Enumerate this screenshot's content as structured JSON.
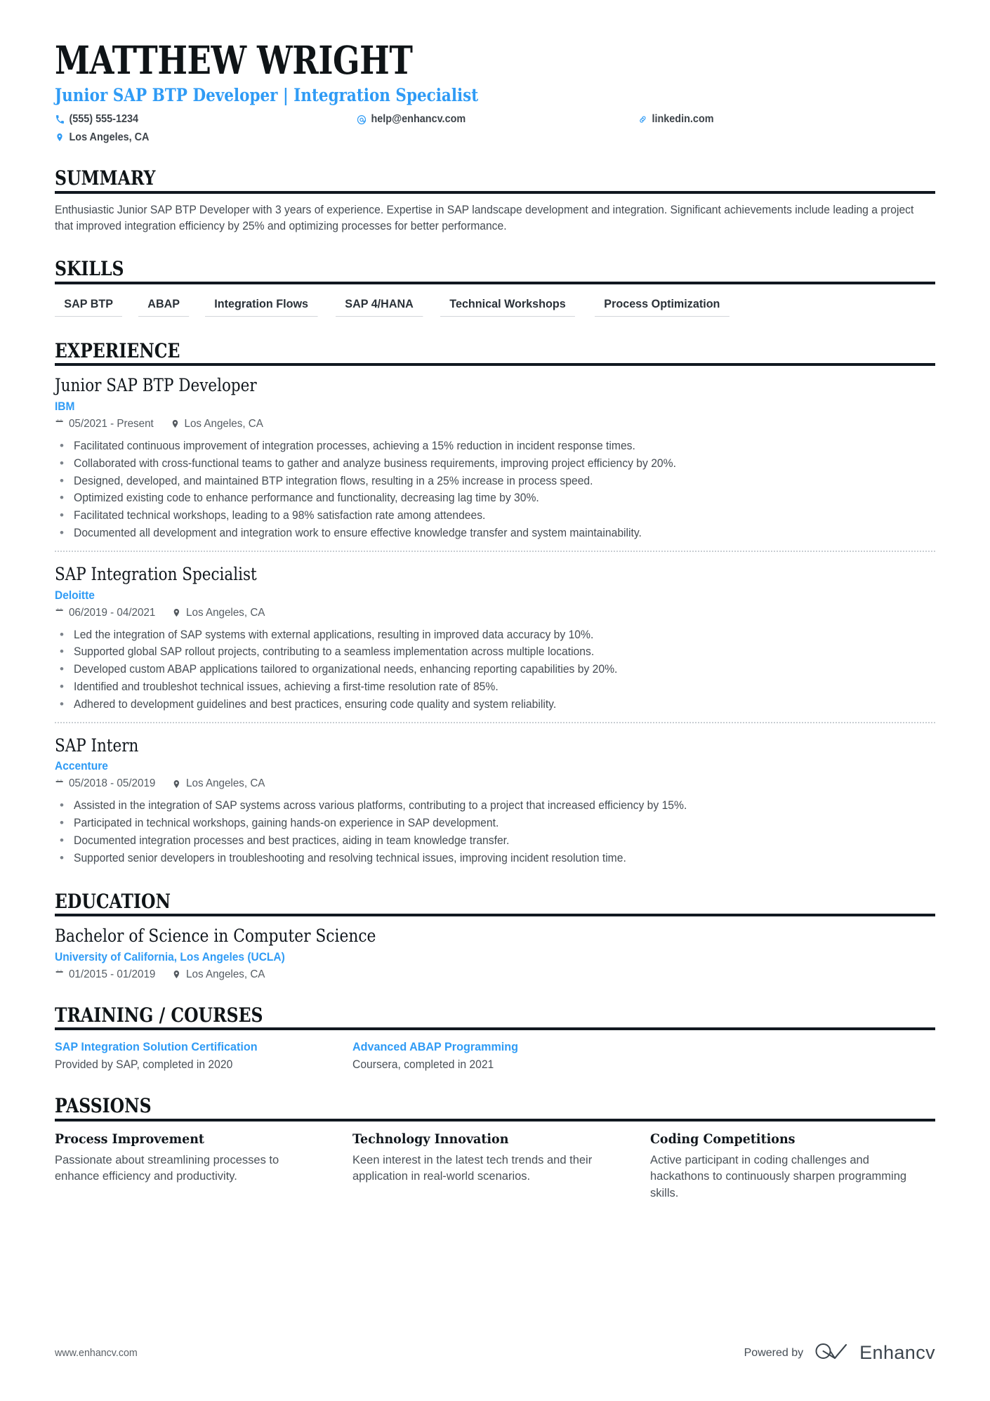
{
  "theme": {
    "accent": "#2f9bf5",
    "text_dark": "#10161c",
    "text_body": "#454c53",
    "rule": "#111820"
  },
  "header": {
    "name": "MATTHEW WRIGHT",
    "headline": "Junior SAP BTP Developer | Integration Specialist",
    "contacts": [
      {
        "icon": "phone-icon",
        "text": "(555) 555-1234"
      },
      {
        "icon": "email-icon",
        "text": "help@enhancv.com"
      },
      {
        "icon": "link-icon",
        "text": "linkedin.com"
      },
      {
        "icon": "location-icon",
        "text": "Los Angeles, CA"
      }
    ]
  },
  "summary": {
    "heading": "SUMMARY",
    "text": "Enthusiastic Junior SAP BTP Developer with 3 years of experience. Expertise in SAP landscape development and integration. Significant achievements include leading a project that improved integration efficiency by 25% and optimizing processes for better performance."
  },
  "skills": {
    "heading": "SKILLS",
    "items": [
      "SAP BTP",
      "ABAP",
      "Integration Flows",
      "SAP 4/HANA",
      "Technical Workshops",
      "Process Optimization"
    ]
  },
  "experience": {
    "heading": "EXPERIENCE",
    "entries": [
      {
        "title": "Junior SAP BTP Developer",
        "company": "IBM",
        "dates": "05/2021 - Present",
        "location": "Los Angeles, CA",
        "bullets": [
          "Facilitated continuous improvement of integration processes, achieving a 15% reduction in incident response times.",
          "Collaborated with cross-functional teams to gather and analyze business requirements, improving project efficiency by 20%.",
          "Designed, developed, and maintained BTP integration flows, resulting in a 25% increase in process speed.",
          "Optimized existing code to enhance performance and functionality, decreasing lag time by 30%.",
          "Facilitated technical workshops, leading to a 98% satisfaction rate among attendees.",
          "Documented all development and integration work to ensure effective knowledge transfer and system maintainability."
        ]
      },
      {
        "title": "SAP Integration Specialist",
        "company": "Deloitte",
        "dates": "06/2019 - 04/2021",
        "location": "Los Angeles, CA",
        "bullets": [
          "Led the integration of SAP systems with external applications, resulting in improved data accuracy by 10%.",
          "Supported global SAP rollout projects, contributing to a seamless implementation across multiple locations.",
          "Developed custom ABAP applications tailored to organizational needs, enhancing reporting capabilities by 20%.",
          "Identified and troubleshot technical issues, achieving a first-time resolution rate of 85%.",
          "Adhered to development guidelines and best practices, ensuring code quality and system reliability."
        ]
      },
      {
        "title": "SAP Intern",
        "company": "Accenture",
        "dates": "05/2018 - 05/2019",
        "location": "Los Angeles, CA",
        "bullets": [
          "Assisted in the integration of SAP systems across various platforms, contributing to a project that increased efficiency by 15%.",
          "Participated in technical workshops, gaining hands-on experience in SAP development.",
          "Documented integration processes and best practices, aiding in team knowledge transfer.",
          "Supported senior developers in troubleshooting and resolving technical issues, improving incident resolution time."
        ]
      }
    ]
  },
  "education": {
    "heading": "EDUCATION",
    "entries": [
      {
        "degree": "Bachelor of Science in Computer Science",
        "school": "University of California, Los Angeles (UCLA)",
        "dates": "01/2015 - 01/2019",
        "location": "Los Angeles, CA"
      }
    ]
  },
  "training": {
    "heading": "TRAINING / COURSES",
    "entries": [
      {
        "name": "SAP Integration Solution Certification",
        "description": "Provided by SAP, completed in 2020"
      },
      {
        "name": "Advanced ABAP Programming",
        "description": "Coursera, completed in 2021"
      }
    ]
  },
  "passions": {
    "heading": "PASSIONS",
    "entries": [
      {
        "title": "Process Improvement",
        "description": "Passionate about streamlining processes to enhance efficiency and productivity."
      },
      {
        "title": "Technology Innovation",
        "description": "Keen interest in the latest tech trends and their application in real-world scenarios."
      },
      {
        "title": "Coding Competitions",
        "description": "Active participant in coding challenges and hackathons to continuously sharpen programming skills."
      }
    ]
  },
  "footer": {
    "url": "www.enhancv.com",
    "powered_by": "Powered by",
    "brand": "Enhancv"
  }
}
